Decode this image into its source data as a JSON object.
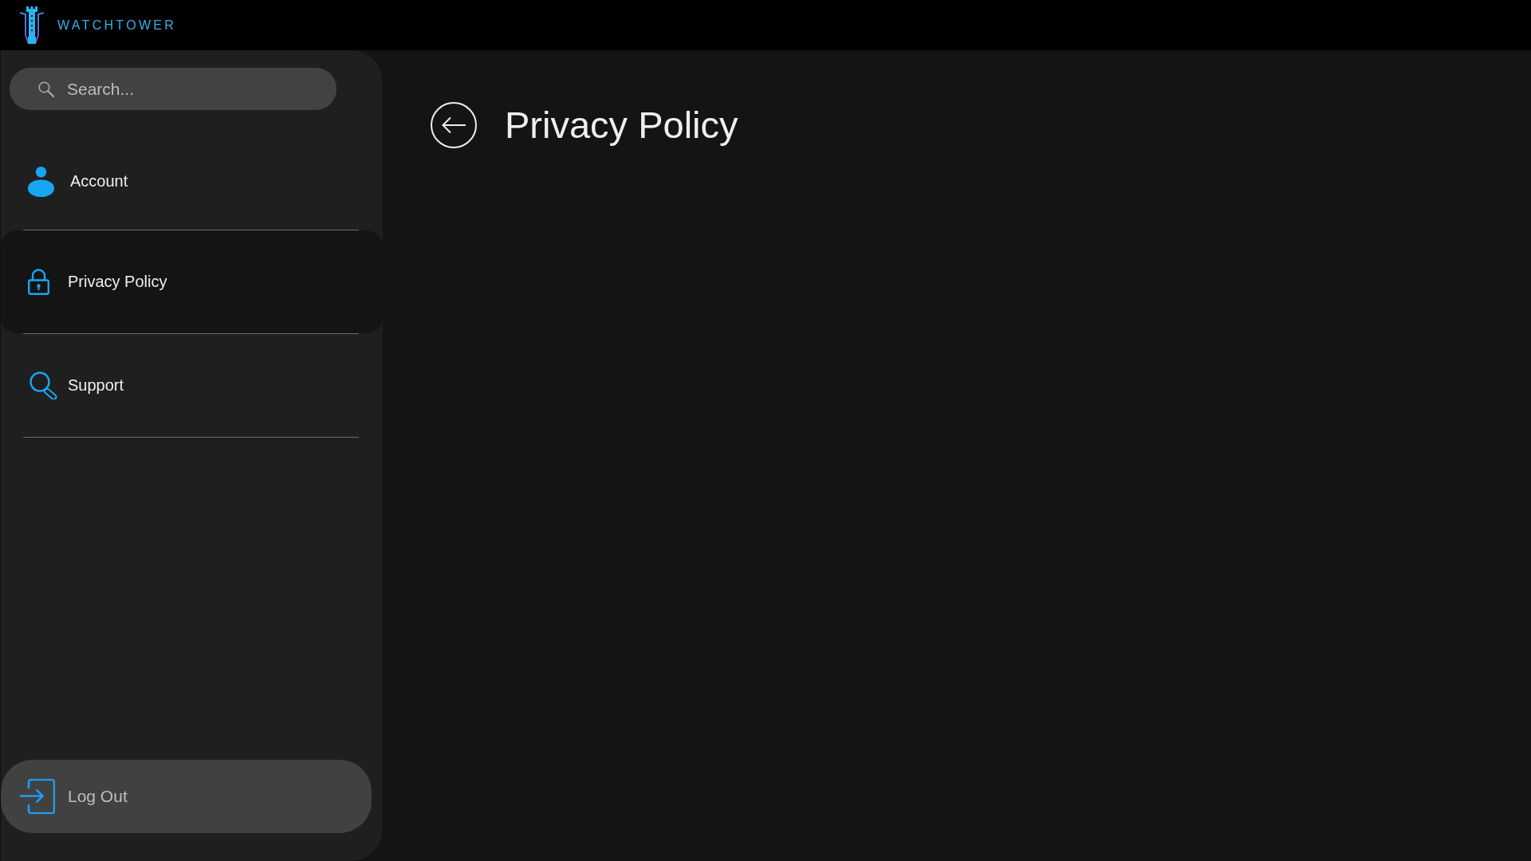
{
  "app": {
    "name": "WATCHTOWER"
  },
  "sidebar": {
    "search": {
      "placeholder": "Search..."
    },
    "items": [
      {
        "kind": "account",
        "label": "Account",
        "selected": false
      },
      {
        "kind": "privacy",
        "label": "Privacy Policy",
        "selected": true
      },
      {
        "kind": "support",
        "label": "Support",
        "selected": false
      }
    ],
    "logout": {
      "label": "Log Out"
    }
  },
  "page": {
    "title": "Privacy Policy"
  }
}
